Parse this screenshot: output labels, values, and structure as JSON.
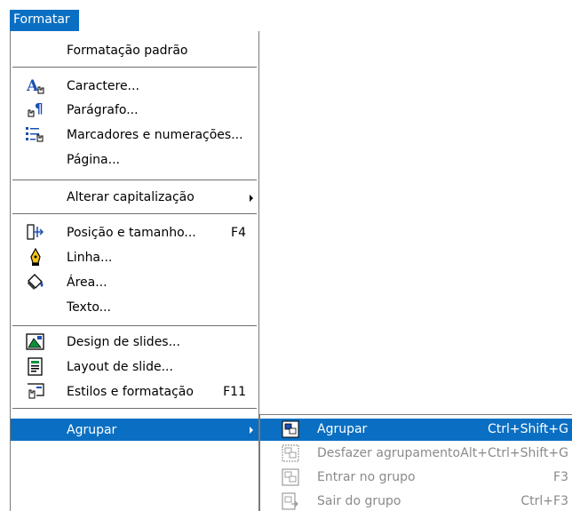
{
  "menubar": {
    "format_menu": "Formatar"
  },
  "menu": {
    "items": [
      {
        "label": "Formatação padrão",
        "icon": "none"
      },
      {
        "label": "Caractere...",
        "icon": "character-icon"
      },
      {
        "label": "Parágrafo...",
        "icon": "paragraph-icon"
      },
      {
        "label": "Marcadores e numerações...",
        "icon": "bullets-numbering-icon"
      },
      {
        "label": "Página...",
        "icon": "none"
      },
      {
        "label": "Alterar capitalização",
        "icon": "none",
        "submenu": true
      },
      {
        "label": "Posição e tamanho...",
        "icon": "position-size-icon",
        "shortcut": "F4"
      },
      {
        "label": "Linha...",
        "icon": "line-icon"
      },
      {
        "label": "Área...",
        "icon": "area-icon"
      },
      {
        "label": "Texto...",
        "icon": "none"
      },
      {
        "label": "Design de slides...",
        "icon": "slide-design-icon"
      },
      {
        "label": "Layout de slide...",
        "icon": "slide-layout-icon"
      },
      {
        "label": "Estilos e formatação",
        "icon": "styles-formatting-icon",
        "shortcut": "F11"
      },
      {
        "label": "Agrupar",
        "icon": "none",
        "submenu": true,
        "highlighted": true
      }
    ]
  },
  "submenu": {
    "items": [
      {
        "label": "Agrupar",
        "shortcut": "Ctrl+Shift+G",
        "icon": "group-icon",
        "highlighted": true,
        "enabled": true
      },
      {
        "label": "Desfazer agrupamento",
        "shortcut": "Alt+Ctrl+Shift+G",
        "icon": "ungroup-icon",
        "enabled": false
      },
      {
        "label": "Entrar no grupo",
        "shortcut": "F3",
        "icon": "enter-group-icon",
        "enabled": false
      },
      {
        "label": "Sair do grupo",
        "shortcut": "Ctrl+F3",
        "icon": "exit-group-icon",
        "enabled": false
      }
    ]
  },
  "colors": {
    "highlight": "#0a6fc2",
    "disabled_text": "#8a8a8a",
    "separator": "#6e6e6e"
  }
}
